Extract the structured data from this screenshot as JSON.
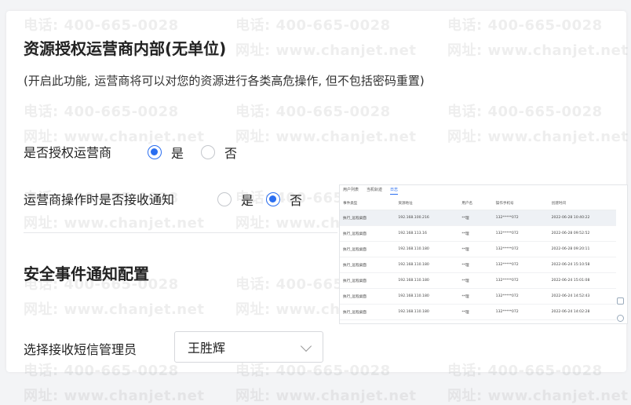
{
  "watermark": {
    "phone": "电话: 400-665-0028",
    "site": "网址: www.chanjet.net"
  },
  "auth_section": {
    "title": "资源授权运营商内部(无单位)",
    "note": "(开启此功能, 运营商将可以对您的资源进行各类高危操作, 但不包括密码重置)"
  },
  "authorize": {
    "label": "是否授权运营商",
    "options": [
      {
        "label": "是",
        "checked": true
      },
      {
        "label": "否",
        "checked": false
      }
    ]
  },
  "notify": {
    "label": "运营商操作时是否接收通知",
    "options": [
      {
        "label": "是",
        "checked": false
      },
      {
        "label": "否",
        "checked": true
      }
    ]
  },
  "security_section": {
    "title": "安全事件通知配置"
  },
  "sms_admin": {
    "label": "选择接收短信管理员",
    "selected": "王胜辉"
  },
  "preview": {
    "tabs": [
      "用户列表",
      "当机轨迹",
      "日志"
    ],
    "active_tab": 2,
    "columns": [
      "事件类型",
      "资源地址",
      "用户名",
      "操作手机号",
      "创建时间"
    ],
    "rows": [
      [
        "执行_远程桌面",
        "192.168.100.216",
        "**理",
        "132*****072",
        "2022-06-28 10:40:22"
      ],
      [
        "执行_远程桌面",
        "192.168.113.16",
        "**理",
        "132*****072",
        "2022-06-28 09:52:52"
      ],
      [
        "执行_远程桌面",
        "192.168.110.180",
        "**理",
        "132*****072",
        "2022-06-28 09:20:11"
      ],
      [
        "执行_远程桌面",
        "192.168.110.180",
        "**理",
        "132*****072",
        "2022-06-24 15:10:58"
      ],
      [
        "执行_远程桌面",
        "192.168.110.180",
        "**理",
        "132*****072",
        "2022-06-24 15:01:08"
      ],
      [
        "执行_远程桌面",
        "192.168.110.180",
        "**理",
        "132*****072",
        "2022-06-24 14:52:43"
      ],
      [
        "执行_远程桌面",
        "192.168.110.180",
        "**理",
        "132*****072",
        "2022-06-24 14:02:28"
      ],
      [
        "执行_远程桌面",
        "192.168.110.180",
        "**理",
        "132*****072",
        "2022-06-24 13:59:30"
      ],
      [
        "执行_远程桌面",
        "192.168.110.180",
        "**理",
        "132*****072",
        "2022-06-24 13:09:21"
      ]
    ]
  },
  "colors": {
    "accent": "#2a6ef0",
    "border": "#d6d8dc"
  }
}
